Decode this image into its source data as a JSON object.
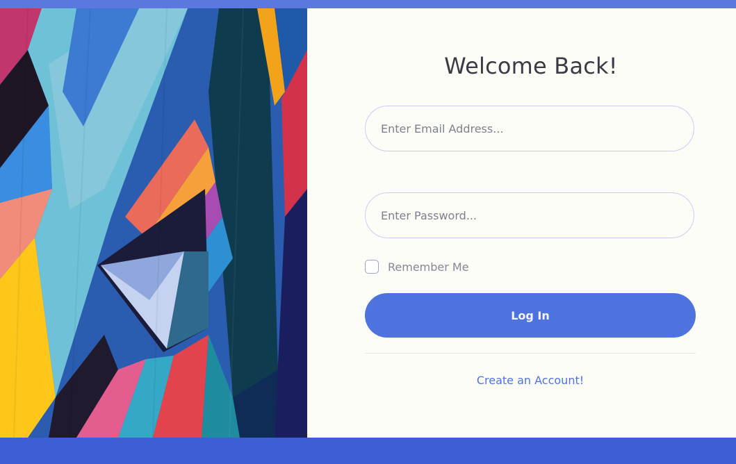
{
  "login": {
    "title": "Welcome Back!",
    "email_placeholder": "Enter Email Address...",
    "password_placeholder": "Enter Password...",
    "remember_label": "Remember Me",
    "login_button": "Log In",
    "create_account_link": "Create an Account!"
  },
  "theme": {
    "accent": "#4e73df",
    "background": "#fdfdf8",
    "title_color": "#3a3b45",
    "muted_text": "#858796"
  },
  "art": {
    "description_icon": "abstract-geometric-mural-image"
  }
}
